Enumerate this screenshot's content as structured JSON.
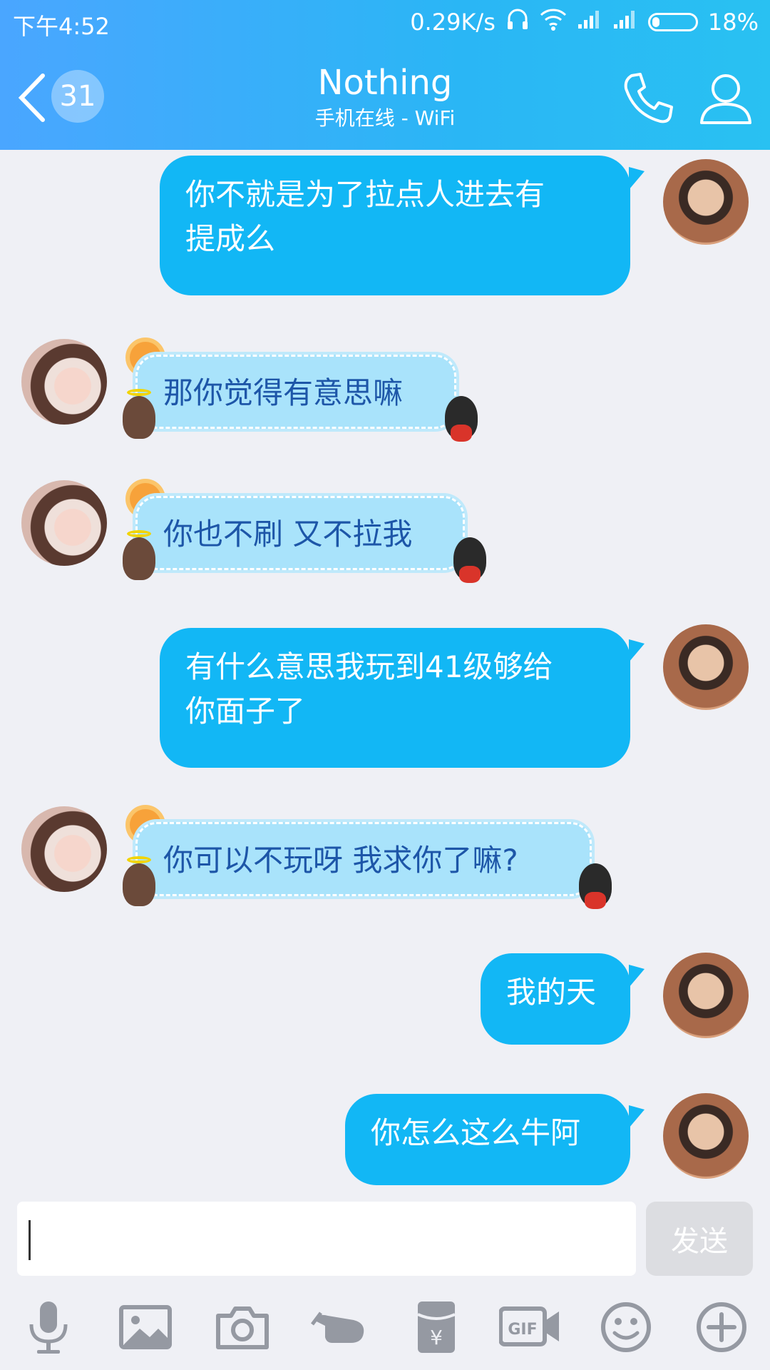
{
  "status_bar": {
    "time": "下午4:52",
    "network_speed": "0.29K/s",
    "battery": "18%",
    "battery_level": 0.18
  },
  "header": {
    "unread_count": "31",
    "contact_name": "Nothing",
    "contact_status": "手机在线 - WiFi"
  },
  "messages": [
    {
      "from": "me",
      "text_lines": [
        "你不就是为了拉点人进去有",
        "提成么"
      ]
    },
    {
      "from": "them",
      "text_lines": [
        "那你觉得有意思嘛"
      ]
    },
    {
      "from": "them",
      "text_lines": [
        "你也不刷 又不拉我"
      ]
    },
    {
      "from": "me",
      "text_lines": [
        "有什么意思我玩到41级够给",
        "你面子了"
      ]
    },
    {
      "from": "them",
      "text_lines": [
        "你可以不玩呀 我求你了嘛?"
      ]
    },
    {
      "from": "me",
      "text_lines": [
        "我的天"
      ]
    },
    {
      "from": "me",
      "text_lines": [
        "你怎么这么牛阿"
      ]
    }
  ],
  "input": {
    "value": "",
    "send_label": "发送"
  },
  "toolbar": {
    "icons": [
      "microphone-icon",
      "image-icon",
      "camera-icon",
      "poke-icon",
      "red-packet-icon",
      "gif-icon",
      "emoji-icon",
      "plus-icon"
    ]
  },
  "colors": {
    "header_gradient_start": "#4aa6ff",
    "header_gradient_end": "#29c1f2",
    "outgoing_bubble": "#12b7f5",
    "incoming_bubble": "#a9e3fb",
    "incoming_text": "#1d56a8",
    "background": "#eff0f5"
  }
}
